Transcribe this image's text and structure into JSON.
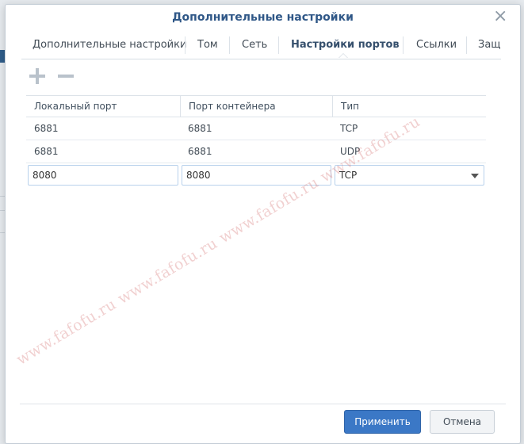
{
  "dialog": {
    "title": "Дополнительные настройки"
  },
  "tabs": [
    {
      "label": "Дополнительные настройки",
      "active": false
    },
    {
      "label": "Том",
      "active": false
    },
    {
      "label": "Сеть",
      "active": false
    },
    {
      "label": "Настройки портов",
      "active": true
    },
    {
      "label": "Ссылки",
      "active": false
    },
    {
      "label": "Защи",
      "active": false
    }
  ],
  "toolbar": {
    "add_icon": "plus-icon",
    "remove_icon": "minus-icon"
  },
  "table": {
    "columns": [
      "Локальный порт",
      "Порт контейнера",
      "Тип"
    ],
    "rows": [
      {
        "local": "6881",
        "container": "6881",
        "type": "TCP"
      },
      {
        "local": "6881",
        "container": "6881",
        "type": "UDP"
      }
    ],
    "editing_row": {
      "local": "8080",
      "container": "8080",
      "type": "TCP"
    }
  },
  "watermark": "www.fafofu.ru www.fafofu.ru www.fafofu.ru www.fafofu.ru",
  "buttons": {
    "apply": "Применить",
    "cancel": "Отмена"
  },
  "colors": {
    "accent": "#3b78c6",
    "title": "#2f5787"
  }
}
